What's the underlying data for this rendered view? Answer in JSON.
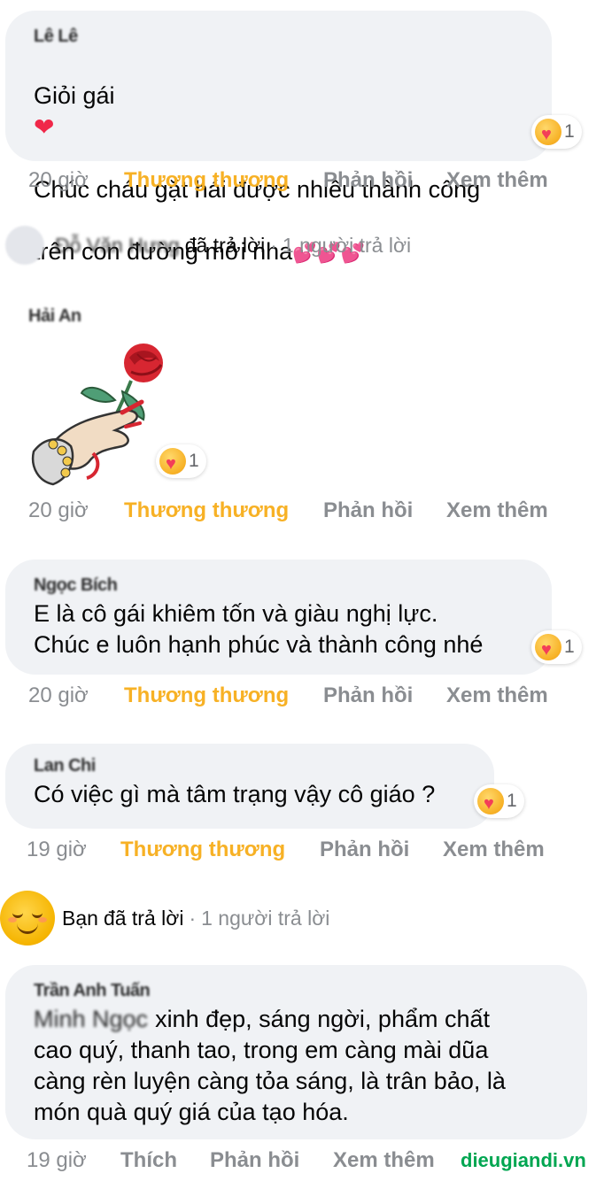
{
  "comments": [
    {
      "author": "Lê Lê",
      "text_line1": "Giỏi gái",
      "text_line2": "Chúc cháu gặt hái được nhiều thành công",
      "text_line3": "trên con đường mới nha",
      "reaction_count": "1",
      "time": "20 giờ",
      "react_label": "Thương thương",
      "reply_label": "Phản hồi",
      "more_label": "Xem thêm"
    },
    {
      "author": "Hải An",
      "reaction_count": "1",
      "time": "20 giờ",
      "react_label": "Thương thương",
      "reply_label": "Phản hồi",
      "more_label": "Xem thêm"
    },
    {
      "author": "Ngọc Bích",
      "text": "E là cô gái khiêm tốn và giàu nghị lực.\nChúc e luôn hạnh phúc và thành công nhé",
      "reaction_count": "1",
      "time": "20 giờ",
      "react_label": "Thương thương",
      "reply_label": "Phản hồi",
      "more_label": "Xem thêm"
    },
    {
      "author": "Lan Chi",
      "text": "Có việc gì mà tâm trạng vậy cô giáo ?",
      "reaction_count": "1",
      "time": "19 giờ",
      "react_label": "Thương thương",
      "reply_label": "Phản hồi",
      "more_label": "Xem thêm"
    },
    {
      "author": "Trần Anh Tuấn",
      "text": "xinh đẹp, sáng ngời, phẩm chất\ncao quý, thanh tao, trong em càng mài dũa\ncàng rèn luyện càng tỏa sáng, là trân bảo, là\nmón quà quý giá của tạo hóa.",
      "text_prefix": "Minh Ngọc",
      "time": "19 giờ",
      "react_label": "Thích",
      "reply_label": "Phản hồi",
      "more_label": "Xem thêm"
    }
  ],
  "replies": [
    {
      "name": "Đỗ Văn Hưng",
      "action": "đã trả lời",
      "count": "1 người trả lời",
      "separator": "·"
    },
    {
      "name": "Bạn",
      "action": "đã trả lời",
      "count": "1 người trả lời",
      "separator": "·"
    }
  ],
  "watermark": "dieugiandi.vn",
  "colors": {
    "bubble": "#f0f2f5",
    "muted": "#8a8d91",
    "care_reaction": "#f7b125",
    "watermark": "#00a651"
  }
}
